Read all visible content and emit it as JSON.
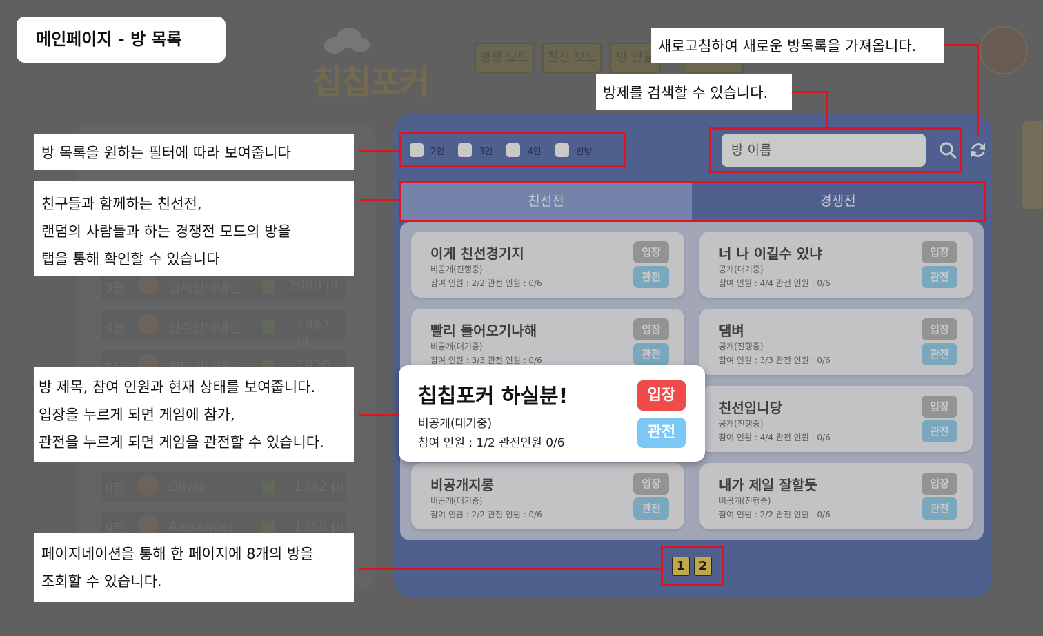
{
  "page_title": "메인페이지 - 방 목록",
  "background": {
    "logo_text": "칩칩포커",
    "nav": [
      "경쟁 모드",
      "친선 모드",
      "방 만들"
    ],
    "ranking": [
      {
        "rank": "3등",
        "name": "임세원닉네임",
        "points": "2000 pt"
      },
      {
        "rank": "4등",
        "name": "선수언닉네임",
        "points": "1967 pt"
      },
      {
        "rank": "5등",
        "name": "최민기닉네임",
        "points": "1920 pt"
      },
      {
        "rank": "8등",
        "name": "Olivia",
        "points": "1392 pt"
      },
      {
        "rank": "9등",
        "name": "Alexander",
        "points": "1350 pt"
      }
    ]
  },
  "filters": [
    {
      "label": "2인"
    },
    {
      "label": "3인"
    },
    {
      "label": "4인"
    },
    {
      "label": "빈방"
    }
  ],
  "search": {
    "placeholder": "방 이름"
  },
  "tabs": [
    {
      "label": "친선전",
      "active": true
    },
    {
      "label": "경쟁전",
      "active": false
    }
  ],
  "rooms": [
    {
      "title": "이게 친선경기지",
      "status": "비공개(진행중)",
      "info": "참여 인원 : 2/2 관전 인원 : 0/6"
    },
    {
      "title": "너 나 이길수 있냐",
      "status": "공개(대기중)",
      "info": "참여 인원 : 4/4 관전 인원 : 0/6"
    },
    {
      "title": "빨리 들어오기나해",
      "status": "비공개(대기중)",
      "info": "참여 인원 : 3/3 관전 인원 : 0/6"
    },
    {
      "title": "댐벼",
      "status": "공개(진행중)",
      "info": "참여 인원 : 3/3 관전 인원 : 0/6"
    },
    {
      "title": "친선입니당",
      "status": "공개(진행중)",
      "info": "참여 인원 : 4/4 관전 인원 : 0/6"
    },
    {
      "title": "비공개지롱",
      "status": "비공개(대기중)",
      "info": "참여 인원 : 2/2 관전 인원 : 0/6"
    },
    {
      "title": "내가 제일 잘할듯",
      "status": "비공개(진행중)",
      "info": "참여 인원 : 2/2 관전 인원 : 0/6"
    }
  ],
  "room_buttons": {
    "enter": "입장",
    "watch": "관전"
  },
  "featured_room": {
    "title": "칩칩포커 하실분!",
    "status": "비공개(대기중)",
    "info": "참여 인원 : 1/2 관전인원 0/6"
  },
  "pagination": [
    "1",
    "2"
  ],
  "annotations": {
    "refresh": "새로고침하여 새로운 방목록을 가져옵니다.",
    "search": "방제를 검색할 수 있습니다.",
    "filter": "방 목록을 원하는 필터에 따라 보여줍니다",
    "tabs": [
      "친구들과 함께하는 친선전,",
      "랜덤의 사람들과 하는 경쟁전 모드의 방을",
      "탭을 통해 확인할 수 있습니다"
    ],
    "room": [
      "방 제목, 참여 인원과 현재 상태를 보여줍니다.",
      "입장을 누르게 되면 게임에 참가,",
      "관전을 누르게 되면 게임을 관전할 수 있습니다."
    ],
    "pagination": [
      "페이지네이션을 통해 한 페이지에 8개의 방을",
      "조회할 수 있습니다."
    ]
  },
  "colors": {
    "panel": "#566cae",
    "active_tab": "#8a9ed3",
    "enter": "#f04a4a",
    "watch": "#7cc8f4",
    "annotation": "#e0141e",
    "page_btn": "#f6d24a"
  }
}
